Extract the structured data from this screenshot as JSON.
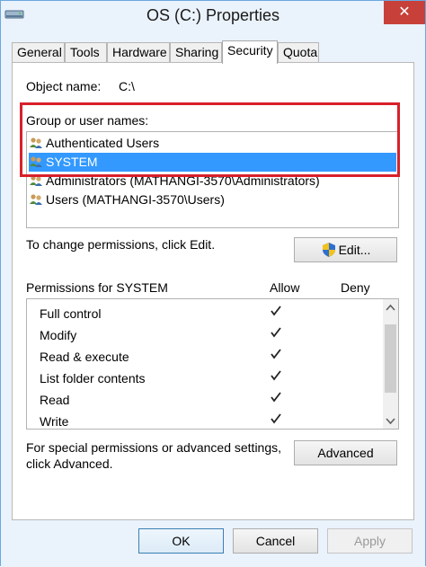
{
  "window": {
    "title": "OS (C:) Properties",
    "close_glyph": "✕"
  },
  "tabs": [
    {
      "label": "General"
    },
    {
      "label": "Tools"
    },
    {
      "label": "Hardware"
    },
    {
      "label": "Sharing"
    },
    {
      "label": "Security",
      "active": true
    },
    {
      "label": "Quota"
    }
  ],
  "security": {
    "object_name_label": "Object name:",
    "object_name_value": "C:\\",
    "group_label": "Group or user names:",
    "users": [
      {
        "name": "Authenticated Users",
        "icon": "users-icon"
      },
      {
        "name": "SYSTEM",
        "icon": "users-icon",
        "selected": true
      },
      {
        "name": "Administrators (MATHANGI-3570\\Administrators)",
        "icon": "users-icon"
      },
      {
        "name": "Users (MATHANGI-3570\\Users)",
        "icon": "users-icon"
      }
    ],
    "change_text": "To change permissions, click Edit.",
    "edit_button": "Edit...",
    "permissions_label": "Permissions for SYSTEM",
    "allow_header": "Allow",
    "deny_header": "Deny",
    "permissions": [
      {
        "name": "Full control",
        "allow": true,
        "deny": false
      },
      {
        "name": "Modify",
        "allow": true,
        "deny": false
      },
      {
        "name": "Read & execute",
        "allow": true,
        "deny": false
      },
      {
        "name": "List folder contents",
        "allow": true,
        "deny": false
      },
      {
        "name": "Read",
        "allow": true,
        "deny": false
      },
      {
        "name": "Write",
        "allow": true,
        "deny": false
      }
    ],
    "special_text_line1": "For special permissions or advanced settings,",
    "special_text_line2": "click Advanced.",
    "advanced_button": "Advanced"
  },
  "footer": {
    "ok": "OK",
    "cancel": "Cancel",
    "apply": "Apply"
  },
  "colors": {
    "selection": "#3399ff",
    "highlight": "#d8202a",
    "close": "#c7413a"
  }
}
